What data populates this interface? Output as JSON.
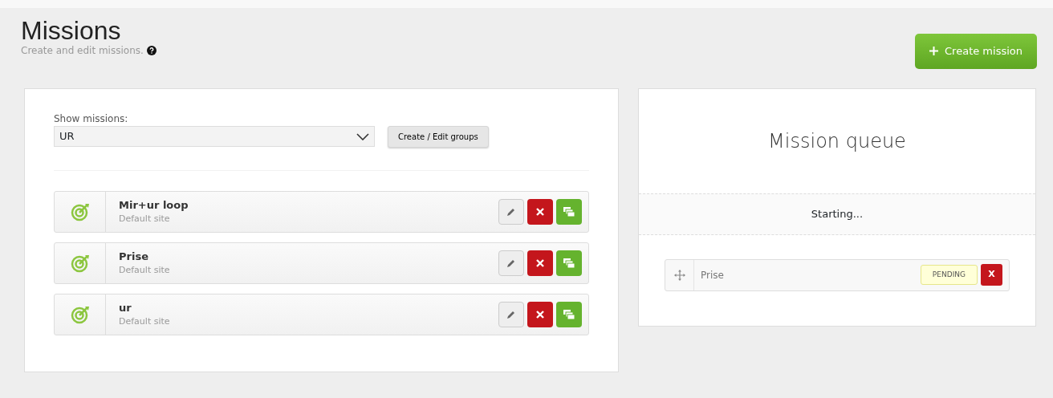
{
  "header": {
    "title": "Missions",
    "subtitle": "Create and edit missions.",
    "create_button": "Create mission"
  },
  "filter": {
    "label": "Show missions:",
    "value": "UR",
    "groups_button": "Create / Edit groups"
  },
  "missions": [
    {
      "name": "Mir+ur loop",
      "site": "Default site"
    },
    {
      "name": "Prise",
      "site": "Default site"
    },
    {
      "name": "ur",
      "site": "Default site"
    }
  ],
  "queue": {
    "title": "Mission queue",
    "status": "Starting...",
    "items": [
      {
        "name": "Prise",
        "state": "PENDING",
        "remove": "X"
      }
    ]
  }
}
